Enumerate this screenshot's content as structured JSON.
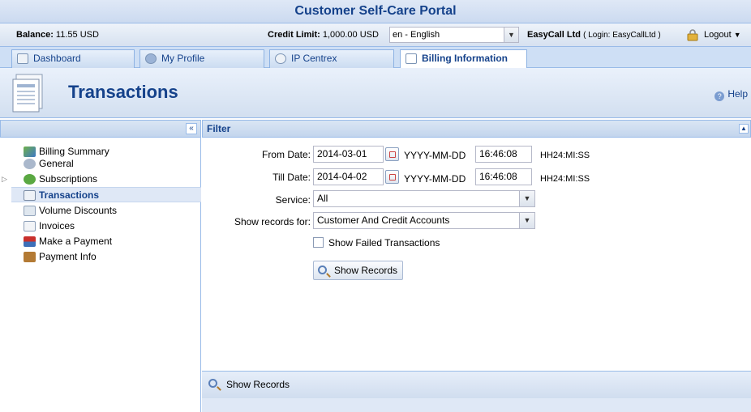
{
  "app": {
    "title": "Customer Self-Care Portal"
  },
  "infobar": {
    "balance_label": "Balance:",
    "balance_value": "11.55 USD",
    "credit_label": "Credit Limit:",
    "credit_value": "1,000.00 USD",
    "language": "en - English",
    "company": "EasyCall Ltd",
    "login": "( Login: EasyCallLtd )",
    "logout": "Logout"
  },
  "tabs": [
    {
      "label": "Dashboard",
      "icon": "dashboard-icon"
    },
    {
      "label": "My Profile",
      "icon": "user-icon"
    },
    {
      "label": "IP Centrex",
      "icon": "gear-icon"
    },
    {
      "label": "Billing Information",
      "icon": "document-icon",
      "active": true
    }
  ],
  "page": {
    "title": "Transactions",
    "help": "Help"
  },
  "sidebar": {
    "items": [
      {
        "label": "Billing Summary",
        "icon": "chart-icon"
      },
      {
        "label": "General",
        "icon": "gear-icon"
      },
      {
        "label": "Subscriptions",
        "icon": "subscriptions-icon"
      },
      {
        "label": "Transactions",
        "icon": "transactions-icon",
        "selected": true
      },
      {
        "label": "Volume Discounts",
        "icon": "discount-icon"
      },
      {
        "label": "Invoices",
        "icon": "invoice-icon"
      },
      {
        "label": "Make a Payment",
        "icon": "payment-icon"
      },
      {
        "label": "Payment Info",
        "icon": "payment-info-icon"
      }
    ]
  },
  "filter": {
    "title": "Filter",
    "from_label": "From Date:",
    "from_date": "2014-03-01",
    "from_time": "16:46:08",
    "till_label": "Till Date:",
    "till_date": "2014-04-02",
    "till_time": "16:46:08",
    "date_format": "YYYY-MM-DD",
    "time_format": "HH24:MI:SS",
    "service_label": "Service:",
    "service_value": "All",
    "records_label": "Show records for:",
    "records_value": "Customer And Credit Accounts",
    "failed_label": "Show Failed Transactions",
    "button_label": "Show Records"
  },
  "bottom": {
    "button_label": "Show Records"
  },
  "colors": {
    "accent": "#15428b",
    "border": "#99bbe8",
    "header_bg": "#dfe8f6"
  }
}
